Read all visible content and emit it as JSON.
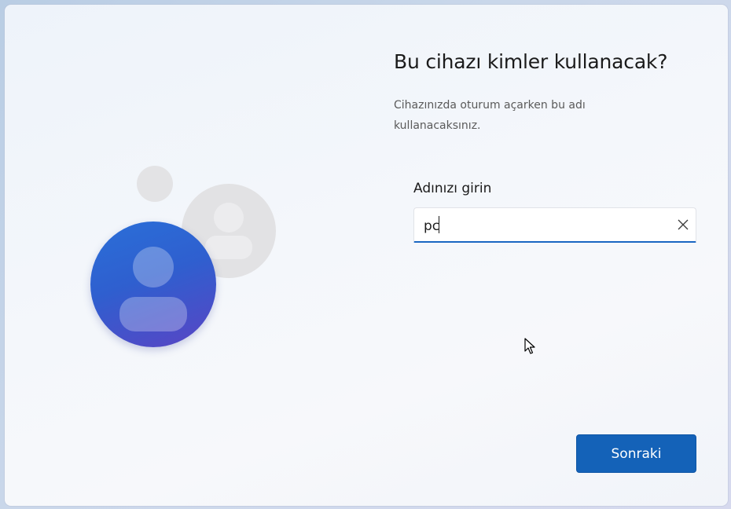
{
  "page": {
    "title": "Bu cihazı kimler kullanacak?",
    "subtitle": "Cihazınızda oturum açarken bu adı kullanacaksınız."
  },
  "form": {
    "label": "Adınızı girin",
    "value": "pc"
  },
  "buttons": {
    "next_label": "Sonraki"
  },
  "icons": {
    "clear": "close-icon",
    "illustration": "user-avatar-icon",
    "cursor": "mouse-pointer-icon"
  },
  "colors": {
    "accent": "#1462b8",
    "avatar_blue": "#2f5fcf",
    "avatar_gray": "#e2e2e4"
  }
}
